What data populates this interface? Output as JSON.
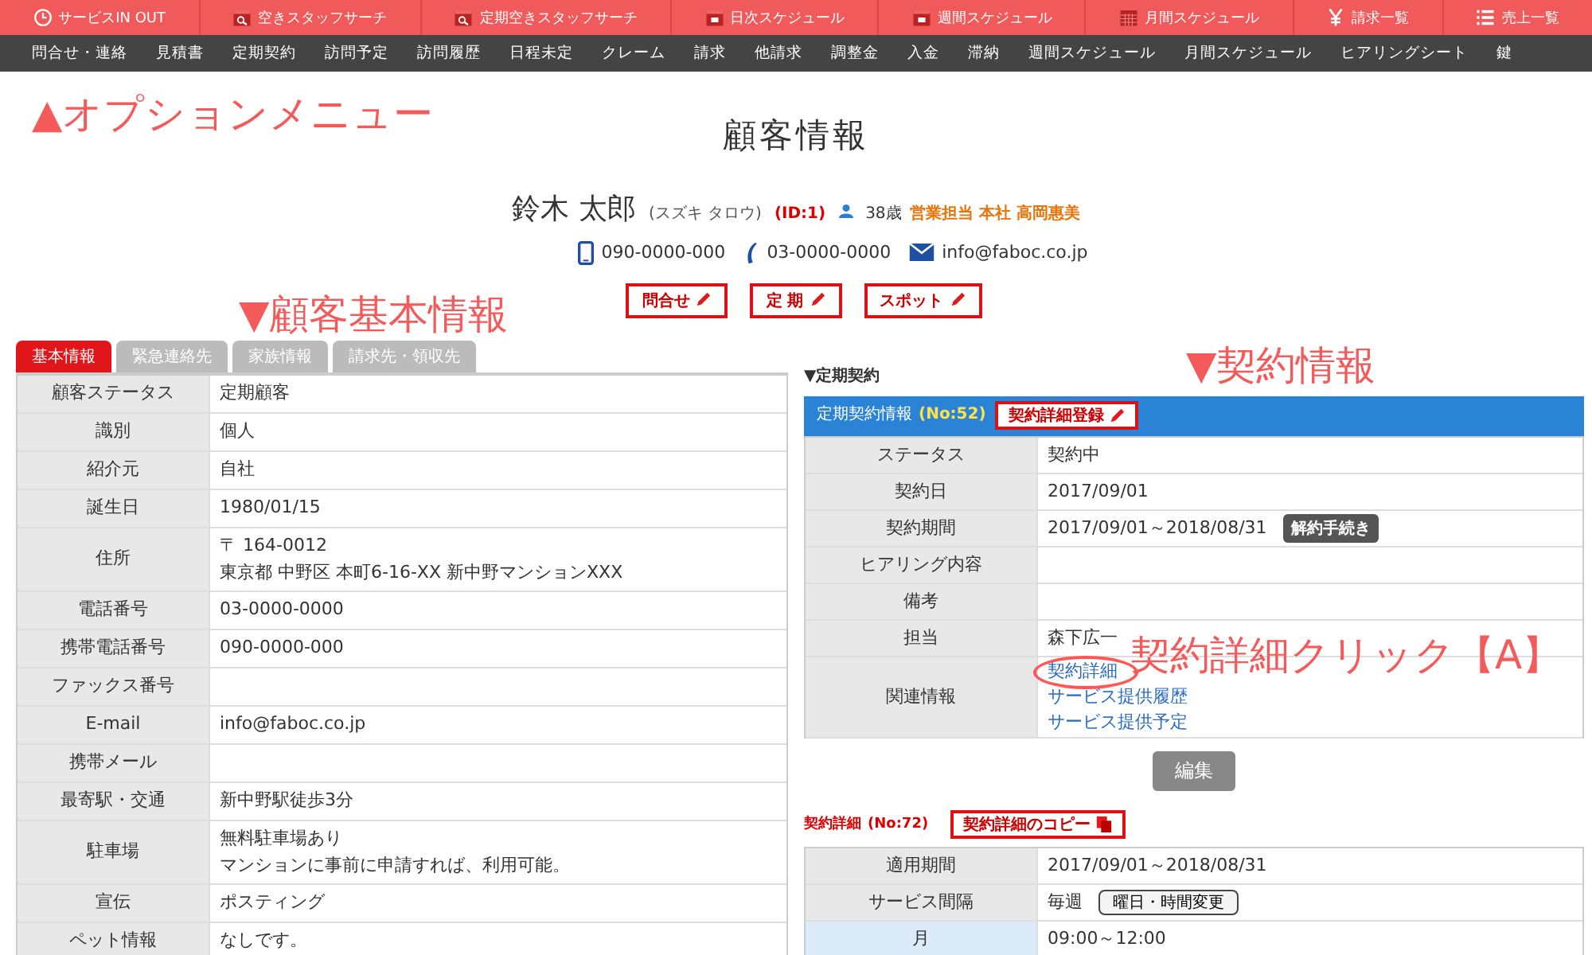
{
  "top_menu": [
    {
      "label": "サービスIN OUT"
    },
    {
      "label": "空きスタッフサーチ"
    },
    {
      "label": "定期空きスタッフサーチ"
    },
    {
      "label": "日次スケジュール"
    },
    {
      "label": "週間スケジュール"
    },
    {
      "label": "月間スケジュール"
    },
    {
      "label": "請求一覧"
    },
    {
      "label": "売上一覧"
    }
  ],
  "nav_menu": [
    "問合せ・連絡",
    "見積書",
    "定期契約",
    "訪問予定",
    "訪問履歴",
    "日程未定",
    "クレーム",
    "請求",
    "他請求",
    "調整金",
    "入金",
    "滞納",
    "週間スケジュール",
    "月間スケジュール",
    "ヒアリングシート",
    "鍵"
  ],
  "annotations": [
    "▲オプションメニュー",
    "▼顧客基本情報",
    "▼契約情報",
    "契約詳細クリック【A】"
  ],
  "customer": {
    "title": "顧客情報",
    "name": "鈴木 太郎",
    "kana": "(スズキ タロウ)",
    "id": "(ID:1)",
    "age": "38歳",
    "staff": "営業担当 本社 高岡惠美",
    "mobile": "090-0000-000",
    "phone": "03-0000-0000",
    "email": "info@faboc.co.jp"
  },
  "action_buttons": [
    "問合せ",
    "定 期",
    "スポット"
  ],
  "tabs": [
    {
      "label": "基本情報",
      "selected": true
    },
    {
      "label": "緊急連絡先",
      "selected": false
    },
    {
      "label": "家族情報",
      "selected": false
    },
    {
      "label": "請求先・領収先",
      "selected": false
    }
  ],
  "basic_rows": [
    {
      "label": "顧客ステータス",
      "values": [
        "定期顧客"
      ]
    },
    {
      "label": "識別",
      "values": [
        "個人"
      ]
    },
    {
      "label": "紹介元",
      "values": [
        "自社"
      ]
    },
    {
      "label": "誕生日",
      "values": [
        "1980/01/15"
      ]
    },
    {
      "label": "住所",
      "values": [
        "〒 164-0012",
        "東京都 中野区 本町6-16-XX 新中野マンションXXX"
      ]
    },
    {
      "label": "電話番号",
      "values": [
        "03-0000-0000"
      ]
    },
    {
      "label": "携帯電話番号",
      "values": [
        "090-0000-000"
      ]
    },
    {
      "label": "ファックス番号"
    },
    {
      "label": "E-mail",
      "values": [
        "info@faboc.co.jp"
      ]
    },
    {
      "label": "携帯メール"
    },
    {
      "label": "最寄駅・交通",
      "values": [
        "新中野駅徒歩3分"
      ]
    },
    {
      "label": "駐車場",
      "values": [
        "無料駐車場あり",
        "マンションに事前に申請すれば、利用可能。"
      ]
    },
    {
      "label": "宣伝",
      "values": [
        "ポスティング"
      ]
    },
    {
      "label": "ペット情報",
      "values": [
        "なしです。"
      ]
    }
  ],
  "contract": {
    "section_title": "▼定期契約",
    "header": "定期契約情報",
    "number": "(No:52)",
    "register_button": "契約詳細登録",
    "rows": [
      {
        "label": "ステータス",
        "value": "契約中"
      },
      {
        "label": "契約日",
        "value": "2017/09/01"
      },
      {
        "label": "契約期間",
        "value": "2017/09/01～2018/08/31",
        "button": "解約手続き"
      },
      {
        "label": "ヒアリング内容"
      },
      {
        "label": "備考"
      },
      {
        "label": "担当",
        "value": "森下広一"
      },
      {
        "label": "関連情報",
        "links": [
          {
            "text": "契約詳細",
            "circled": true
          },
          {
            "text": "サービス提供履歴",
            "circled": false
          },
          {
            "text": "サービス提供予定",
            "circled": false
          }
        ]
      }
    ],
    "edit_button": "編集"
  },
  "detail": {
    "title": "契約詳細",
    "number": "(No:72)",
    "copy_button": "契約詳細のコピー",
    "rows": [
      {
        "label": "適用期間",
        "value": "2017/09/01～2018/08/31",
        "highlight": false
      },
      {
        "label": "サービス間隔",
        "value": "毎週",
        "button": "曜日・時間変更",
        "highlight": false
      },
      {
        "label": "月",
        "value": "09:00～12:00",
        "highlight": true
      }
    ]
  }
}
